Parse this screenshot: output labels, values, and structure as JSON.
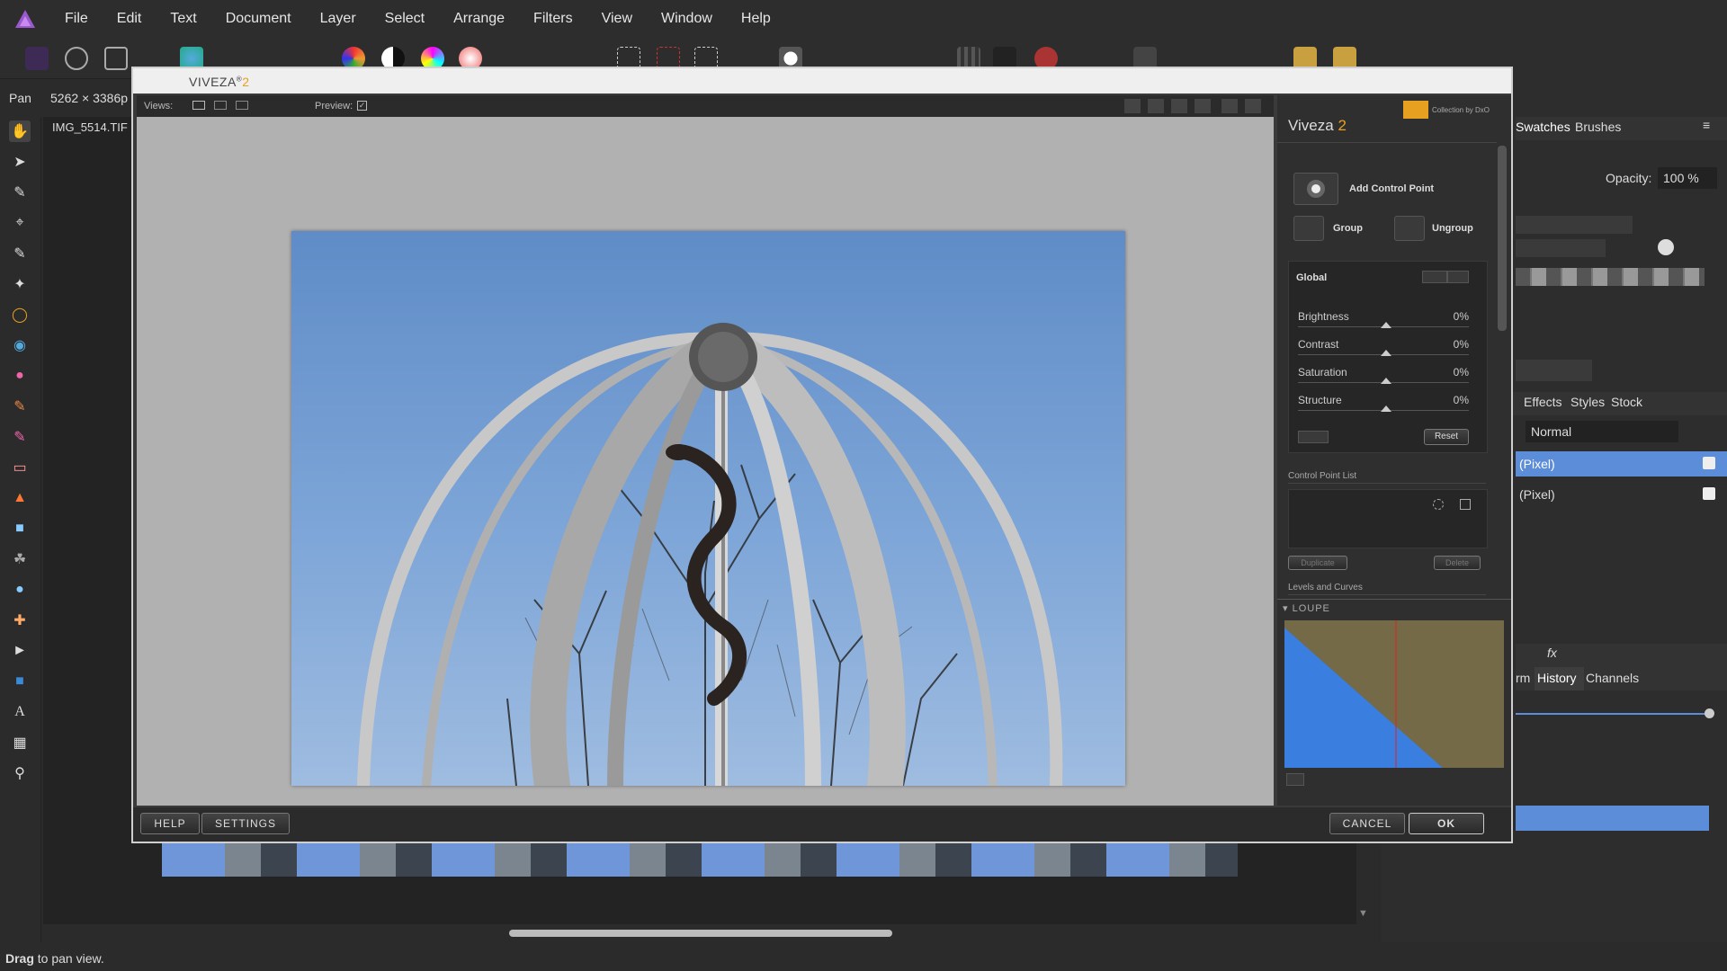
{
  "menubar": {
    "items": [
      "File",
      "Edit",
      "Text",
      "Document",
      "Layer",
      "Select",
      "Arrange",
      "Filters",
      "View",
      "Window",
      "Help"
    ]
  },
  "context": {
    "tool": "Pan",
    "dimensions": "5262 × 3386p"
  },
  "document": {
    "tab_name": "IMG_5514.TIF"
  },
  "statusbar": {
    "bold": "Drag",
    "rest": " to pan view."
  },
  "right_panel": {
    "tabs_top": [
      "Swatches",
      "Brushes"
    ],
    "opacity_label": "Opacity:",
    "opacity_value": "100 %",
    "tabs_mid": [
      "Effects",
      "Styles",
      "Stock"
    ],
    "blend_mode": "Normal",
    "layers": [
      "(Pixel)",
      "(Pixel)"
    ],
    "tabs_bottom": [
      "rm",
      "History",
      "Channels"
    ],
    "colors": {
      "accent": "#5b8dd9"
    }
  },
  "viveza": {
    "title": "VIVEZA",
    "title_sup": "®",
    "title_num": "2",
    "views_label": "Views:",
    "preview_label": "Preview:",
    "brand": "Collection by DxO",
    "panel_title": "Viveza",
    "panel_num": "2",
    "add_control_point": "Add Control Point",
    "group": "Group",
    "ungroup": "Ungroup",
    "global": "Global",
    "sliders": [
      {
        "name": "Brightness",
        "value": "0%"
      },
      {
        "name": "Contrast",
        "value": "0%"
      },
      {
        "name": "Saturation",
        "value": "0%"
      },
      {
        "name": "Structure",
        "value": "0%"
      }
    ],
    "reset": "Reset",
    "control_point_list": "Control Point List",
    "duplicate": "Duplicate",
    "delete": "Delete",
    "levels_curves": "Levels and Curves",
    "loupe": "LOUPE",
    "help": "HELP",
    "settings": "SETTINGS",
    "cancel": "CANCEL",
    "ok": "OK",
    "colors": {
      "orange": "#e8a020"
    }
  }
}
